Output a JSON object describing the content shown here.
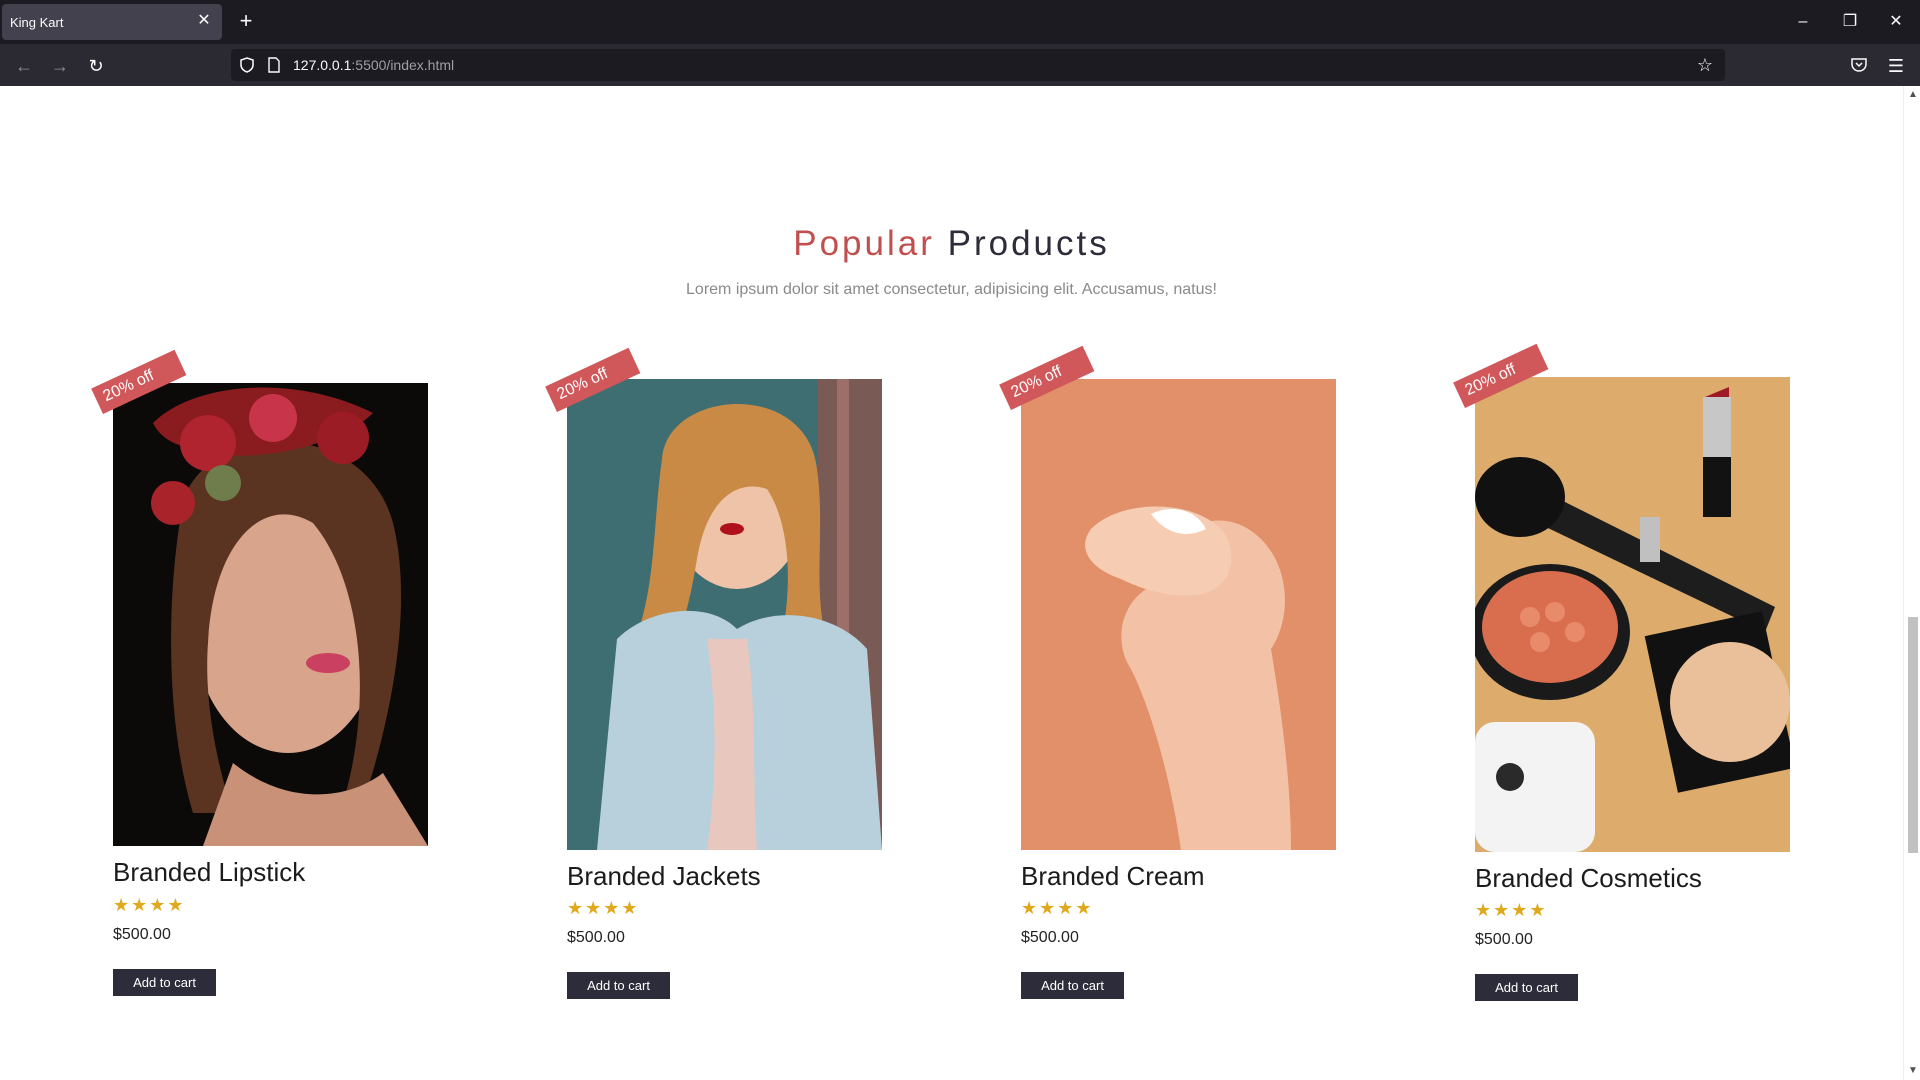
{
  "browser": {
    "tab_title": "King Kart",
    "new_tab": "+",
    "url_host": "127.0.0.1",
    "url_rest": ":5500/index.html"
  },
  "section": {
    "title_accent": "Popular",
    "title_main": "Products",
    "subtitle": "Lorem ipsum dolor sit amet consectetur, adipisicing elit. Accusamus, natus!"
  },
  "products": [
    {
      "name": "Branded Lipstick",
      "badge": "20% off",
      "stars": "★★★★",
      "price": "$500.00",
      "button": "Add to cart"
    },
    {
      "name": "Branded Jackets",
      "badge": "20% off",
      "stars": "★★★★",
      "price": "$500.00",
      "button": "Add to cart"
    },
    {
      "name": "Branded Cream",
      "badge": "20% off",
      "stars": "★★★★",
      "price": "$500.00",
      "button": "Add to cart"
    },
    {
      "name": "Branded Cosmetics",
      "badge": "20% off",
      "stars": "★★★★",
      "price": "$500.00",
      "button": "Add to cart"
    }
  ],
  "colors": {
    "accent": "#c0504f",
    "dark": "#2d2c3a",
    "badge": "#d0575a",
    "star": "#e0a81c"
  }
}
